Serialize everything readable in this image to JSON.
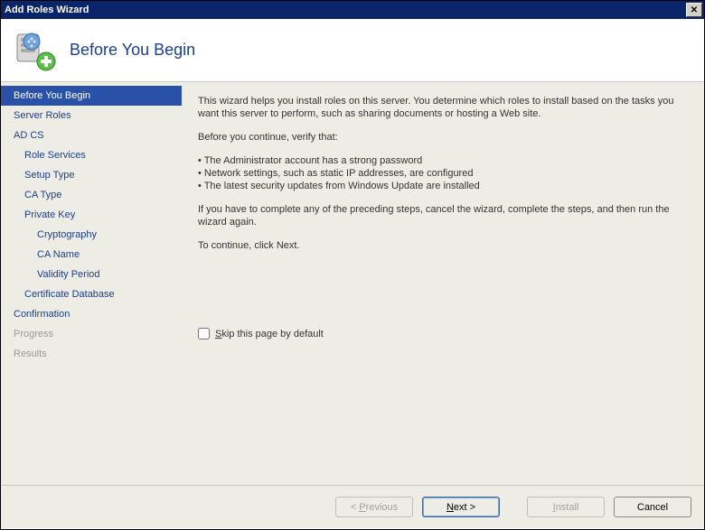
{
  "window": {
    "title": "Add Roles Wizard",
    "close_symbol": "✕"
  },
  "header": {
    "heading": "Before You Begin"
  },
  "sidebar": {
    "items": [
      {
        "label": "Before You Begin",
        "level": 0,
        "state": "selected"
      },
      {
        "label": "Server Roles",
        "level": 0,
        "state": "normal"
      },
      {
        "label": "AD CS",
        "level": 0,
        "state": "normal"
      },
      {
        "label": "Role Services",
        "level": 1,
        "state": "normal"
      },
      {
        "label": "Setup Type",
        "level": 1,
        "state": "normal"
      },
      {
        "label": "CA Type",
        "level": 1,
        "state": "normal"
      },
      {
        "label": "Private Key",
        "level": 1,
        "state": "normal"
      },
      {
        "label": "Cryptography",
        "level": 2,
        "state": "normal"
      },
      {
        "label": "CA Name",
        "level": 2,
        "state": "normal"
      },
      {
        "label": "Validity Period",
        "level": 2,
        "state": "normal"
      },
      {
        "label": "Certificate Database",
        "level": 1,
        "state": "normal"
      },
      {
        "label": "Confirmation",
        "level": 0,
        "state": "normal"
      },
      {
        "label": "Progress",
        "level": 0,
        "state": "disabled"
      },
      {
        "label": "Results",
        "level": 0,
        "state": "disabled"
      }
    ]
  },
  "content": {
    "intro": "This wizard helps you install roles on this server. You determine which roles to install based on the tasks you want this server to perform, such as sharing documents or hosting a Web site.",
    "verify_heading": "Before you continue, verify that:",
    "bullets": [
      "• The Administrator account has a strong password",
      "• Network settings, such as static IP addresses, are configured",
      "• The latest security updates from Windows Update are installed"
    ],
    "restart_note": "If you have to complete any of the preceding steps, cancel the wizard, complete the steps, and then run the wizard again.",
    "continue_note": "To continue, click Next.",
    "skip_label_prefix": "S",
    "skip_label_rest": "kip this page by default",
    "skip_checked": false
  },
  "footer": {
    "previous_prefix": "< ",
    "previous_ul": "P",
    "previous_rest": "revious",
    "next_ul": "N",
    "next_rest": "ext >",
    "install_ul": "I",
    "install_rest": "nstall",
    "cancel": "Cancel",
    "previous_enabled": false,
    "next_enabled": true,
    "install_enabled": false,
    "cancel_enabled": true
  }
}
